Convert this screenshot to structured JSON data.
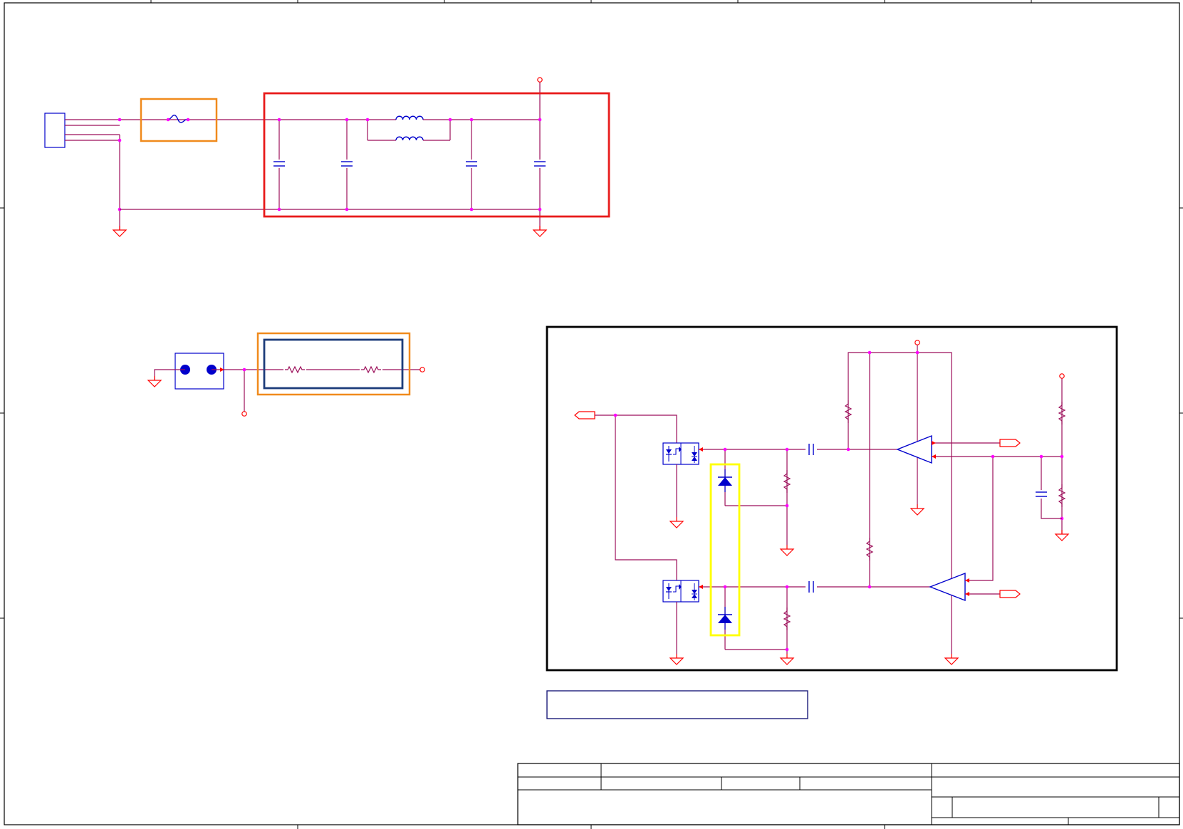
{
  "sheet": {
    "type": "electrical schematic",
    "text_labels": []
  },
  "colors": {
    "wire": "#9c0f5a",
    "component": "#0000cc",
    "junction": "#ff00ff",
    "power_symbol": "#ff0000",
    "highlight_fuse": "#f08a1c",
    "highlight_filter": "#e81b1b",
    "highlight_resistors_outer": "#f08a1c",
    "highlight_resistors_inner": "#1d3d7a",
    "highlight_tvs": "#ffff00",
    "frame": "#000000",
    "note_box": "#1c1c7a"
  },
  "icons": [
    "connector-icon",
    "fuse-icon",
    "inductor-icon",
    "capacitor-icon",
    "resistor-icon",
    "ground-icon",
    "power-port-icon",
    "net-port-icon",
    "optocoupler-icon",
    "tvs-diode-icon",
    "opamp-icon",
    "jack-icon"
  ],
  "title_block": {
    "fields": [
      "",
      "",
      "",
      "",
      "",
      "",
      "",
      ""
    ]
  }
}
